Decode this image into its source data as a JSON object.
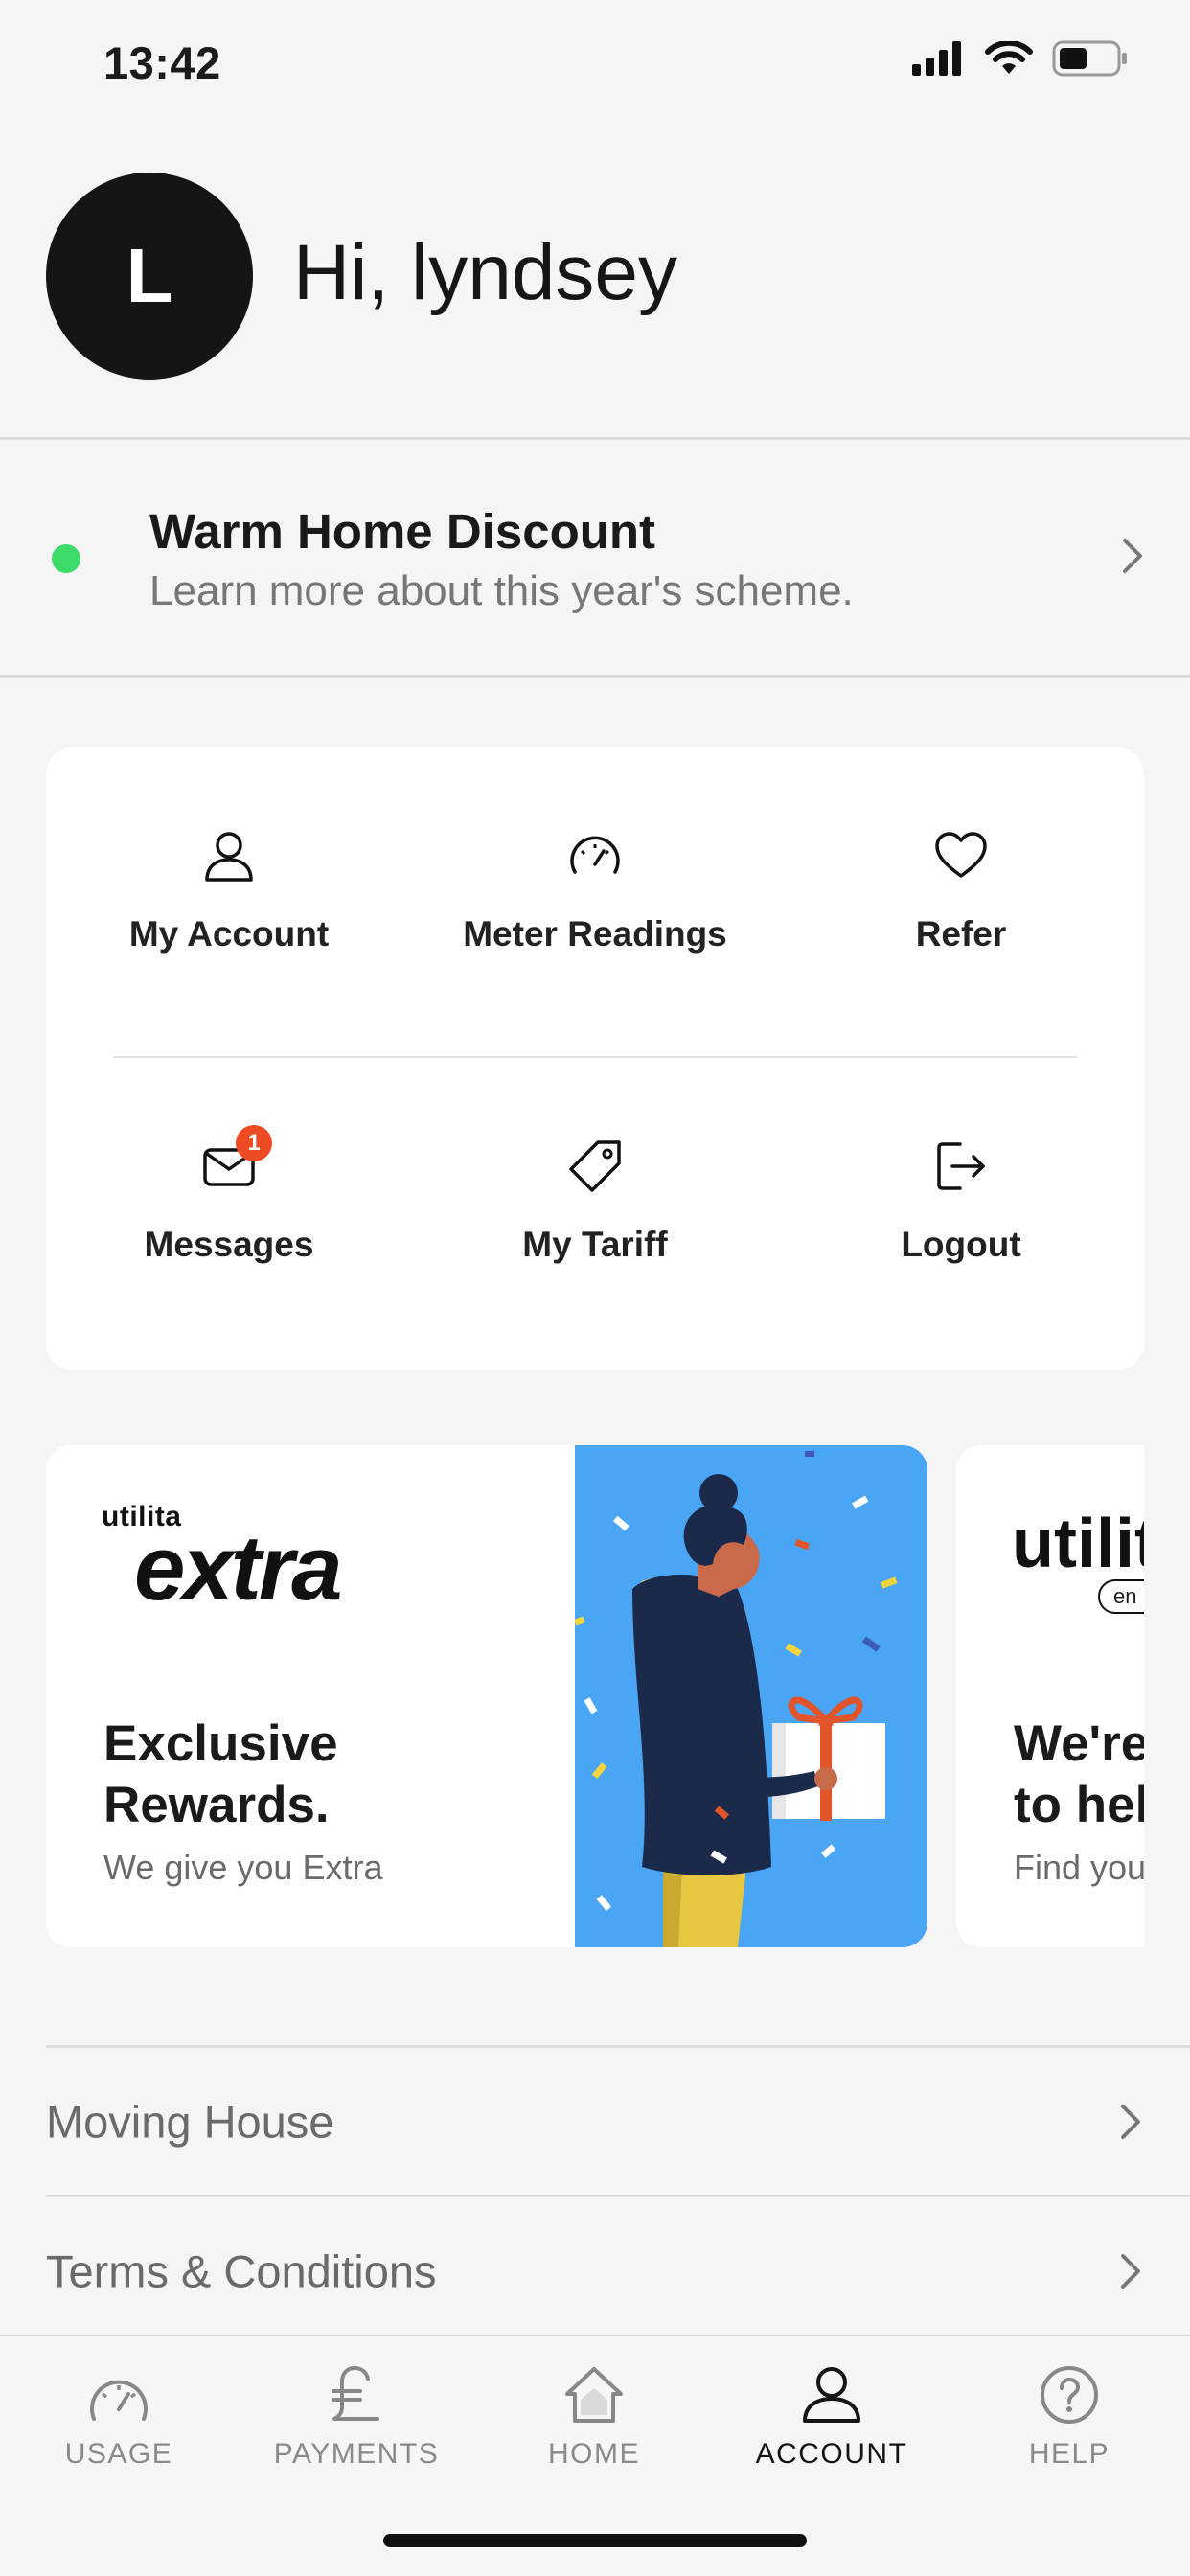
{
  "status_bar": {
    "time": "13:42"
  },
  "profile": {
    "avatar_initial": "L",
    "greeting": "Hi, lyndsey"
  },
  "banner": {
    "title": "Warm Home Discount",
    "subtitle": "Learn more about this year's scheme.",
    "indicator_color": "#3ddc6a"
  },
  "quick_actions": [
    {
      "label": "My Account",
      "icon": "user-icon"
    },
    {
      "label": "Meter Readings",
      "icon": "gauge-icon"
    },
    {
      "label": "Refer",
      "icon": "heart-icon"
    },
    {
      "label": "Messages",
      "icon": "mail-icon",
      "badge": "1"
    },
    {
      "label": "My Tariff",
      "icon": "tag-icon"
    },
    {
      "label": "Logout",
      "icon": "logout-icon"
    }
  ],
  "promos": [
    {
      "brand_small": "utilita",
      "brand_large": "extra",
      "headline_line1": "Exclusive",
      "headline_line2": "Rewards.",
      "subtitle": "We give you Extra"
    },
    {
      "brand_small": "utilit",
      "brand_tag": "en",
      "headline_line1": "We're",
      "headline_line2": "to hel",
      "subtitle": "Find you"
    }
  ],
  "list": [
    {
      "label": "Moving House"
    },
    {
      "label": "Terms & Conditions"
    }
  ],
  "tabs": [
    {
      "label": "USAGE",
      "icon": "gauge-icon"
    },
    {
      "label": "PAYMENTS",
      "icon": "pound-icon"
    },
    {
      "label": "HOME",
      "icon": "home-icon"
    },
    {
      "label": "ACCOUNT",
      "icon": "user-icon",
      "active": true
    },
    {
      "label": "HELP",
      "icon": "help-icon"
    }
  ],
  "colors": {
    "accent_badge": "#ec4b23",
    "promo_background": "#4aa6f5",
    "dark": "#151515"
  }
}
